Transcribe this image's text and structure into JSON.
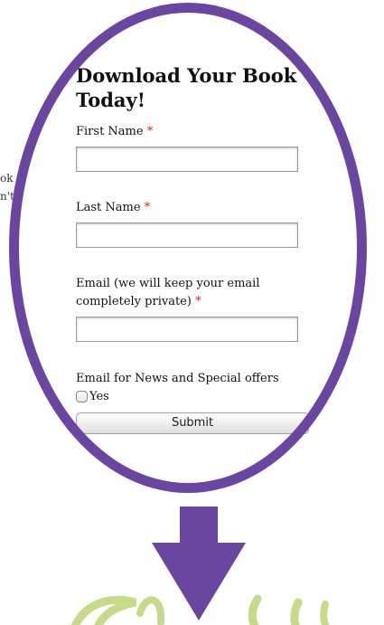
{
  "background": {
    "line1": "ok",
    "line2": "n't"
  },
  "form": {
    "title": "Download Your Book Today!",
    "fields": [
      {
        "label": "First Name",
        "required": "*",
        "value": ""
      },
      {
        "label": "Last Name",
        "required": "*",
        "value": ""
      },
      {
        "label": "Email (we will keep your email completely private)",
        "required": "*",
        "value": ""
      }
    ],
    "newsletter_label": "Email for News and Special offers",
    "checkbox_label": "Yes",
    "checkbox_checked": false,
    "submit_label": "Submit"
  },
  "colors": {
    "accent": "#6a46a0",
    "required": "#d9222a",
    "logo": "#c5db8a"
  }
}
